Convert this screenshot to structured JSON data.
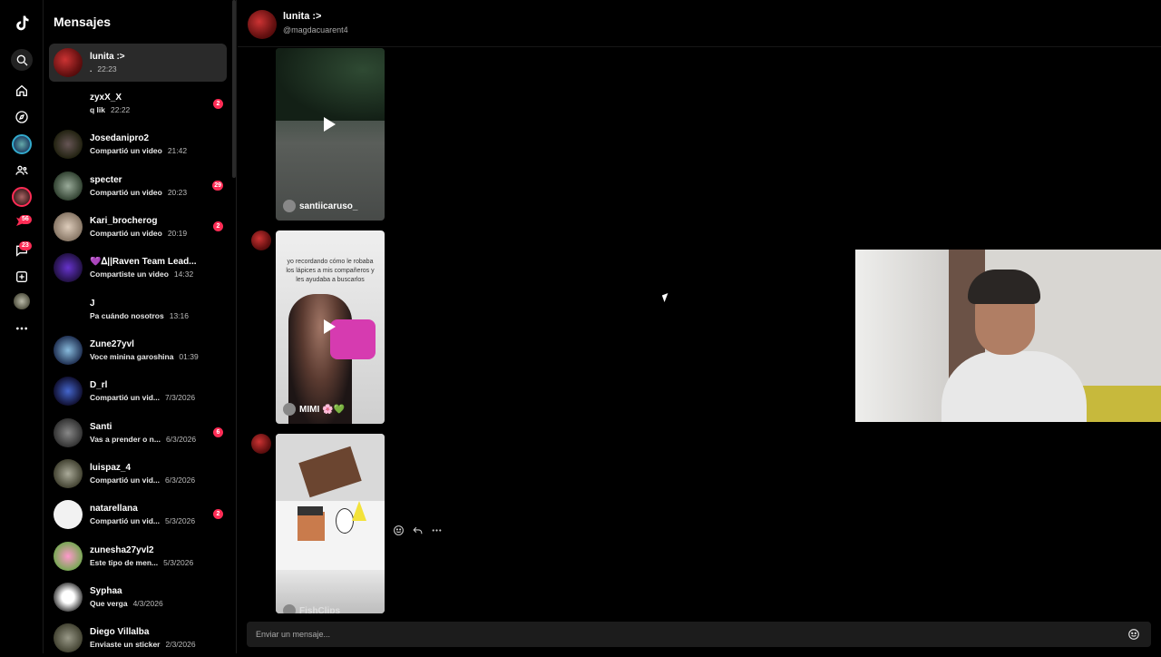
{
  "rail": {
    "badges": {
      "inbox": "56",
      "activity": "23"
    }
  },
  "sidebar": {
    "title": "Mensajes",
    "conversations": [
      {
        "name": "lunita :>",
        "preview": ".",
        "time": "22:23",
        "badge": ""
      },
      {
        "name": "zyxX_X",
        "preview": "q lik",
        "time": "22:22",
        "badge": "2"
      },
      {
        "name": "Josedanipro2",
        "preview": "Compartió un video",
        "time": "21:42",
        "badge": ""
      },
      {
        "name": "specter",
        "preview": "Compartió un video",
        "time": "20:23",
        "badge": "29"
      },
      {
        "name": "Kari_brocherog",
        "preview": "Compartió un video",
        "time": "20:19",
        "badge": "2"
      },
      {
        "name": "💜ᐃ||Raven Team Lead...",
        "preview": "Compartiste un video",
        "time": "14:32",
        "badge": ""
      },
      {
        "name": "J",
        "preview": "Pa cuándo nosotros",
        "time": "13:16",
        "badge": ""
      },
      {
        "name": "Zune27yvl",
        "preview": "Voce minina garoshina",
        "time": "01:39",
        "badge": ""
      },
      {
        "name": "D_rl",
        "preview": "Compartió un vid...",
        "time": "7/3/2026",
        "badge": ""
      },
      {
        "name": "Santi",
        "preview": "Vas a prender o n...",
        "time": "6/3/2026",
        "badge": "6"
      },
      {
        "name": "luispaz_4",
        "preview": "Compartió un vid...",
        "time": "6/3/2026",
        "badge": ""
      },
      {
        "name": "natarellana",
        "preview": "Compartió un vid...",
        "time": "5/3/2026",
        "badge": "2"
      },
      {
        "name": "zunesha27yvl2",
        "preview": "Este tipo de men...",
        "time": "5/3/2026",
        "badge": ""
      },
      {
        "name": "Syphaa",
        "preview": "Que verga",
        "time": "4/3/2026",
        "badge": ""
      },
      {
        "name": "Diego Villalba",
        "preview": "Enviaste un sticker",
        "time": "2/3/2026",
        "badge": ""
      }
    ]
  },
  "header": {
    "name": "lunita :>",
    "handle": "@magdacuarent4"
  },
  "messages": {
    "video1_author": "santiicaruso_",
    "video2_caption": "yo recordando cómo le robaba los lápices a mis compañeros y les ayudaba a buscarlos",
    "video2_author": "MIMI 🌸💚",
    "video3_author": "FishClips"
  },
  "composer": {
    "placeholder": "Enviar un mensaje..."
  }
}
